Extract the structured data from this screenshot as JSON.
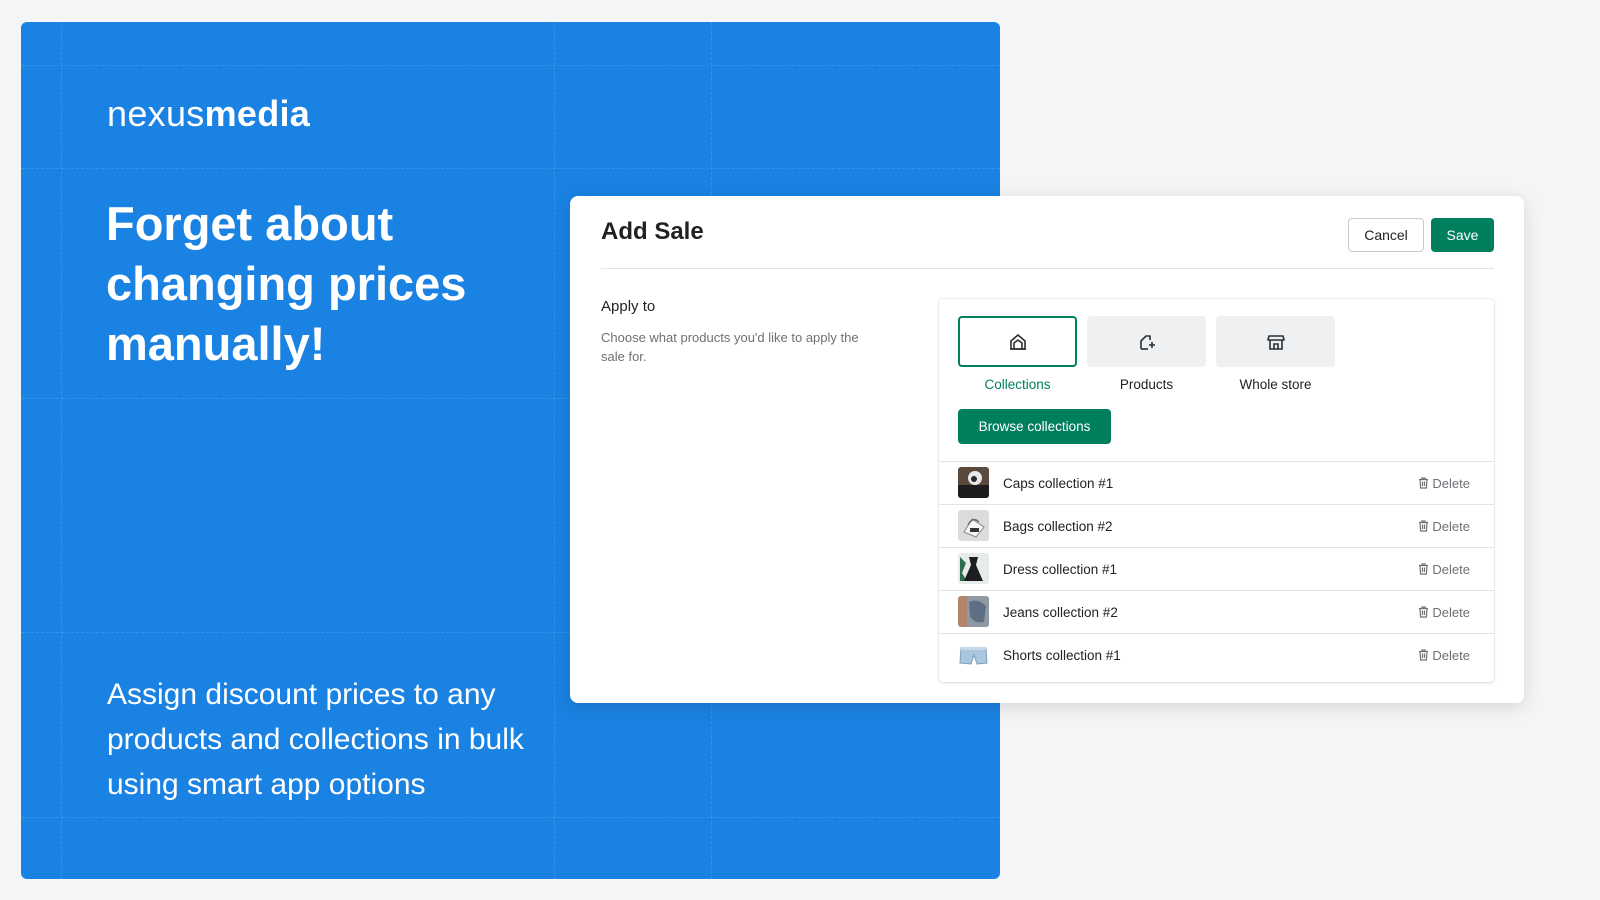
{
  "brand": {
    "logo_light": "nexus",
    "logo_bold": "media"
  },
  "hero": {
    "headline": "Forget about changing prices manually!",
    "subline": "Assign discount prices to any products and collections in bulk using smart app options"
  },
  "modal": {
    "title": "Add Sale",
    "cancel_label": "Cancel",
    "save_label": "Save",
    "apply_title": "Apply to",
    "apply_description": "Choose what products you'd like to apply the sale for.",
    "options": [
      {
        "label": "Collections",
        "icon": "collections-icon",
        "selected": true
      },
      {
        "label": "Products",
        "icon": "product-add-icon",
        "selected": false
      },
      {
        "label": "Whole store",
        "icon": "store-icon",
        "selected": false
      }
    ],
    "browse_label": "Browse collections",
    "delete_label": "Delete",
    "collections": [
      {
        "name": "Caps collection #1",
        "thumb": "cap"
      },
      {
        "name": "Bags collection #2",
        "thumb": "bag"
      },
      {
        "name": "Dress collection #1",
        "thumb": "dress"
      },
      {
        "name": "Jeans collection #2",
        "thumb": "jeans"
      },
      {
        "name": "Shorts collection #1",
        "thumb": "shorts"
      }
    ]
  },
  "colors": {
    "hero_bg": "#1a82e2",
    "accent_green": "#007f5f",
    "page_bg": "#f4f5f6"
  }
}
